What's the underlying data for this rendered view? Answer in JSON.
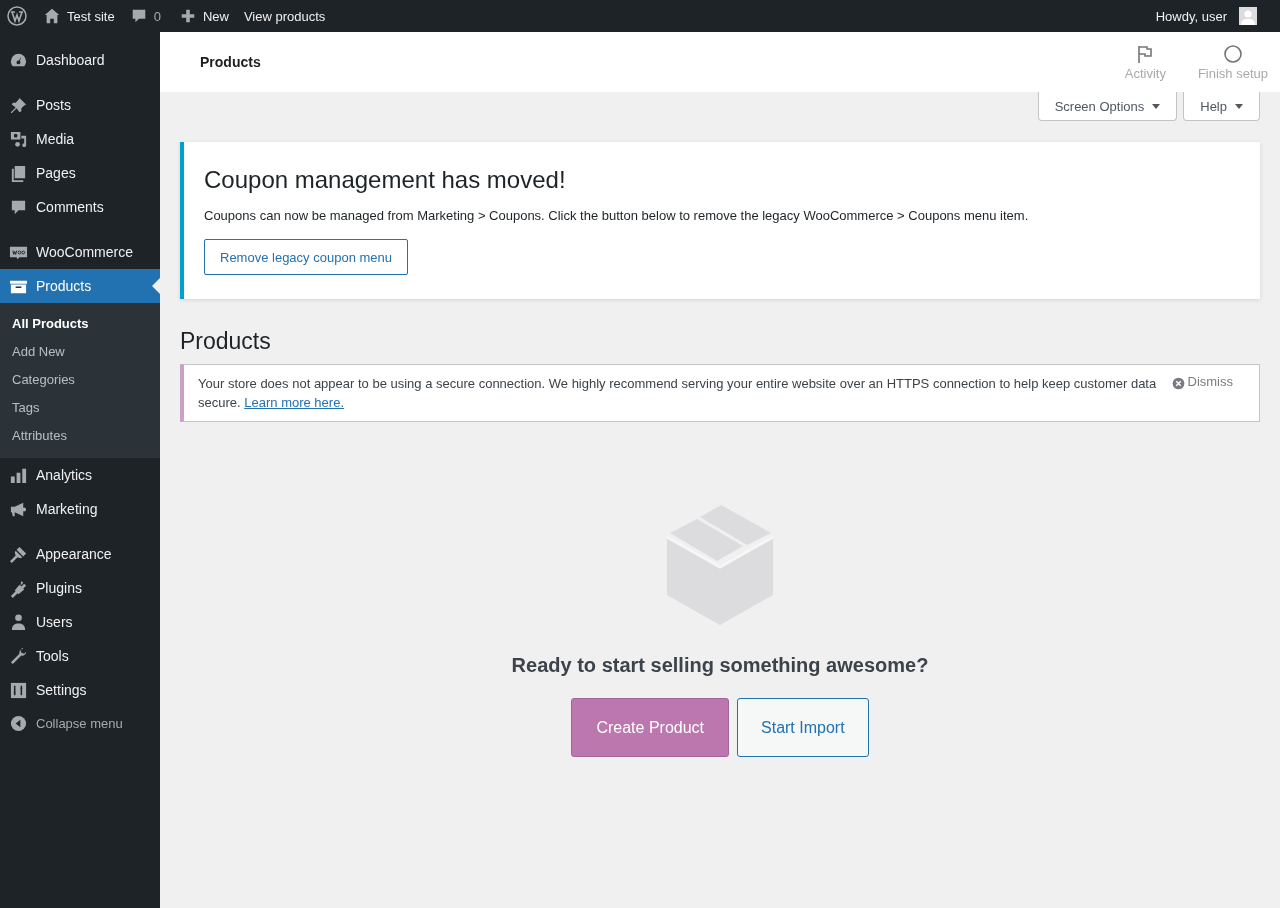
{
  "admin_bar": {
    "site": "Test site",
    "comments": "0",
    "new": "New",
    "view": "View products",
    "greeting": "Howdy, user"
  },
  "sidebar": {
    "groups": [
      {
        "items": [
          {
            "label": "Dashboard",
            "selected": false
          }
        ]
      },
      {
        "items": [
          {
            "label": "Posts",
            "selected": false
          },
          {
            "label": "Media",
            "selected": false
          },
          {
            "label": "Pages",
            "selected": false
          },
          {
            "label": "Comments",
            "selected": false
          }
        ]
      },
      {
        "items": [
          {
            "label": "WooCommerce",
            "selected": false
          },
          {
            "label": "Products",
            "selected": true,
            "children": [
              {
                "label": "All Products",
                "selected": true
              },
              {
                "label": "Add New",
                "selected": false
              },
              {
                "label": "Categories",
                "selected": false
              },
              {
                "label": "Tags",
                "selected": false
              },
              {
                "label": "Attributes",
                "selected": false
              }
            ]
          },
          {
            "label": "Analytics",
            "selected": false
          },
          {
            "label": "Marketing",
            "selected": false
          }
        ]
      },
      {
        "items": [
          {
            "label": "Appearance",
            "selected": false
          },
          {
            "label": "Plugins",
            "selected": false
          },
          {
            "label": "Users",
            "selected": false
          },
          {
            "label": "Tools",
            "selected": false
          },
          {
            "label": "Settings",
            "selected": false
          }
        ]
      }
    ],
    "collapse": "Collapse menu"
  },
  "header": {
    "title": "Products",
    "actions": [
      "Activity",
      "Finish setup"
    ]
  },
  "screen_meta": [
    "Screen Options",
    "Help"
  ],
  "coupon_notice": {
    "title": "Coupon management has moved!",
    "text": "Coupons can now be managed from Marketing > Coupons. Click the button below to remove the legacy WooCommerce > Coupons menu item.",
    "button": "Remove legacy coupon menu"
  },
  "page_title": "Products",
  "secure_notice": {
    "text": "Your store does not appear to be using a secure connection. We highly recommend serving your entire website over an HTTPS connection to help keep customer data secure.",
    "link": "Learn more here.",
    "dismiss": "Dismiss"
  },
  "empty_state": {
    "message": "Ready to start selling something awesome?",
    "buttons": [
      {
        "label": "Create Product",
        "kind": "primary"
      },
      {
        "label": "Start Import",
        "kind": "secondary"
      }
    ]
  }
}
